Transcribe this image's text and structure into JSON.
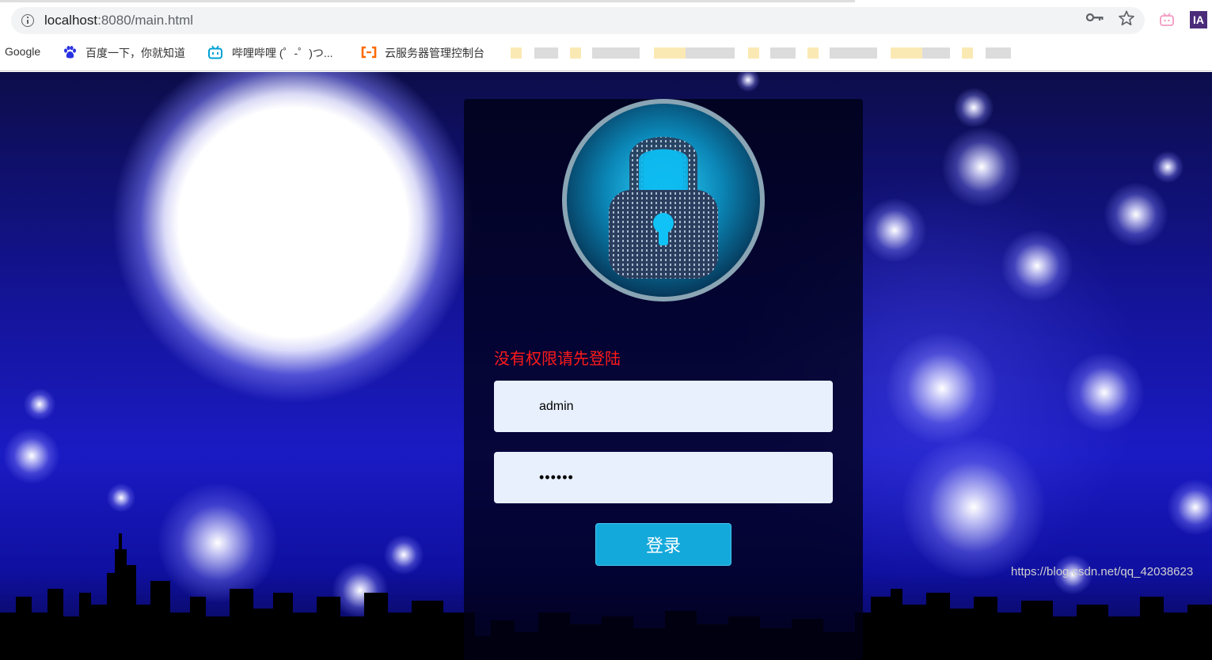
{
  "browser": {
    "url_host": "localhost",
    "url_path": ":8080/main.html",
    "bookmarks": [
      {
        "label": "Google",
        "icon": "none"
      },
      {
        "label": "百度一下，你就知道",
        "icon": "baidu-paw-icon"
      },
      {
        "label": "哔哩哔哩 (゜-゜)つ...",
        "icon": "bilibili-tv-icon"
      },
      {
        "label": "云服务器管理控制台",
        "icon": "aliyun-bracket-icon"
      }
    ],
    "ext_label": "IA",
    "colors": {
      "baidu": "#2932e1",
      "bilibili": "#00a1d6",
      "aliyun": "#ff6a00"
    }
  },
  "login": {
    "error_message": "没有权限请先登陆",
    "username_value": "admin",
    "password_value": "••••••",
    "submit_label": "登录",
    "colors": {
      "error": "#ff1a1a",
      "button": "#14a9db",
      "field_bg": "#e8f0fe"
    }
  },
  "watermark": "https://blog.csdn.net/qq_42038623"
}
